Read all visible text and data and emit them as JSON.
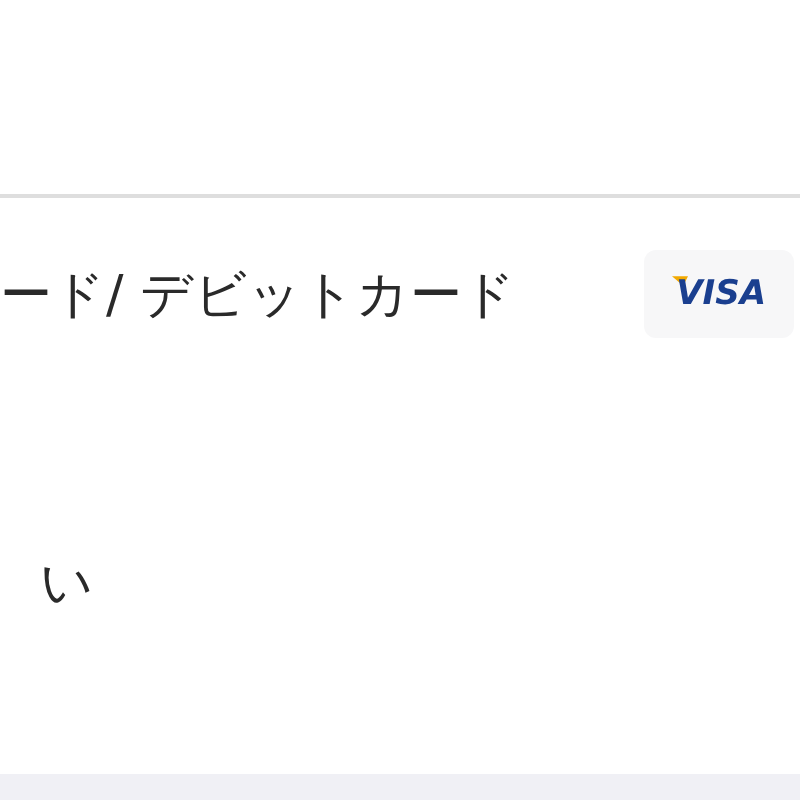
{
  "payment_options": [
    {
      "label": "ード/ デビットカード",
      "kind": "card",
      "logo_text": "VISA"
    },
    {
      "label": "い",
      "kind": "plain"
    }
  ]
}
